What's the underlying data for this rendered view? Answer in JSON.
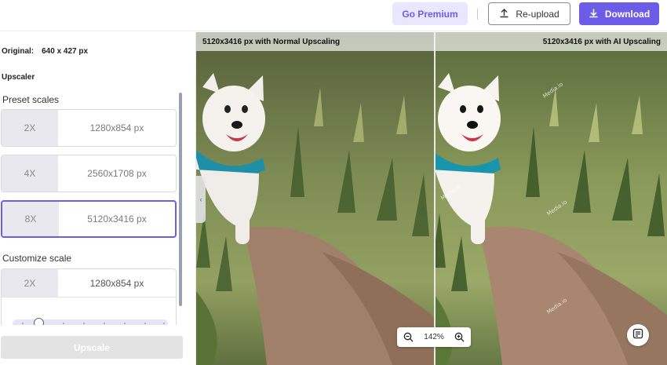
{
  "header": {
    "premium_label": "Go Premium",
    "reupload_label": "Re-upload",
    "download_label": "Download",
    "icons": {
      "reupload": "upload-icon",
      "download": "download-icon"
    },
    "colors": {
      "accent": "#6c5ce7",
      "premium_bg": "#e9e7ff"
    }
  },
  "panel": {
    "original_label": "Original:",
    "original_value": "640 x 427 px",
    "upscaler_label": "Upscaler",
    "preset_title": "Preset scales",
    "presets": [
      {
        "mult": "2X",
        "size": "1280x854 px",
        "selected": false
      },
      {
        "mult": "4X",
        "size": "2560x1708 px",
        "selected": false
      },
      {
        "mult": "8X",
        "size": "5120x3416 px",
        "selected": true
      }
    ],
    "custom_title": "Customize scale",
    "custom": {
      "mult": "2X",
      "size": "1280x854 px"
    },
    "upscale_label": "Upscale"
  },
  "viewer": {
    "left_caption": "5120x3416 px with Normal Upscaling",
    "right_caption": "5120x3416 px with AI Upscaling",
    "zoom_level": "142%",
    "icons": {
      "zoom_out": "zoom-out-icon",
      "zoom_in": "zoom-in-icon",
      "feedback": "feedback-icon"
    },
    "watermark_text": "Media.io"
  }
}
